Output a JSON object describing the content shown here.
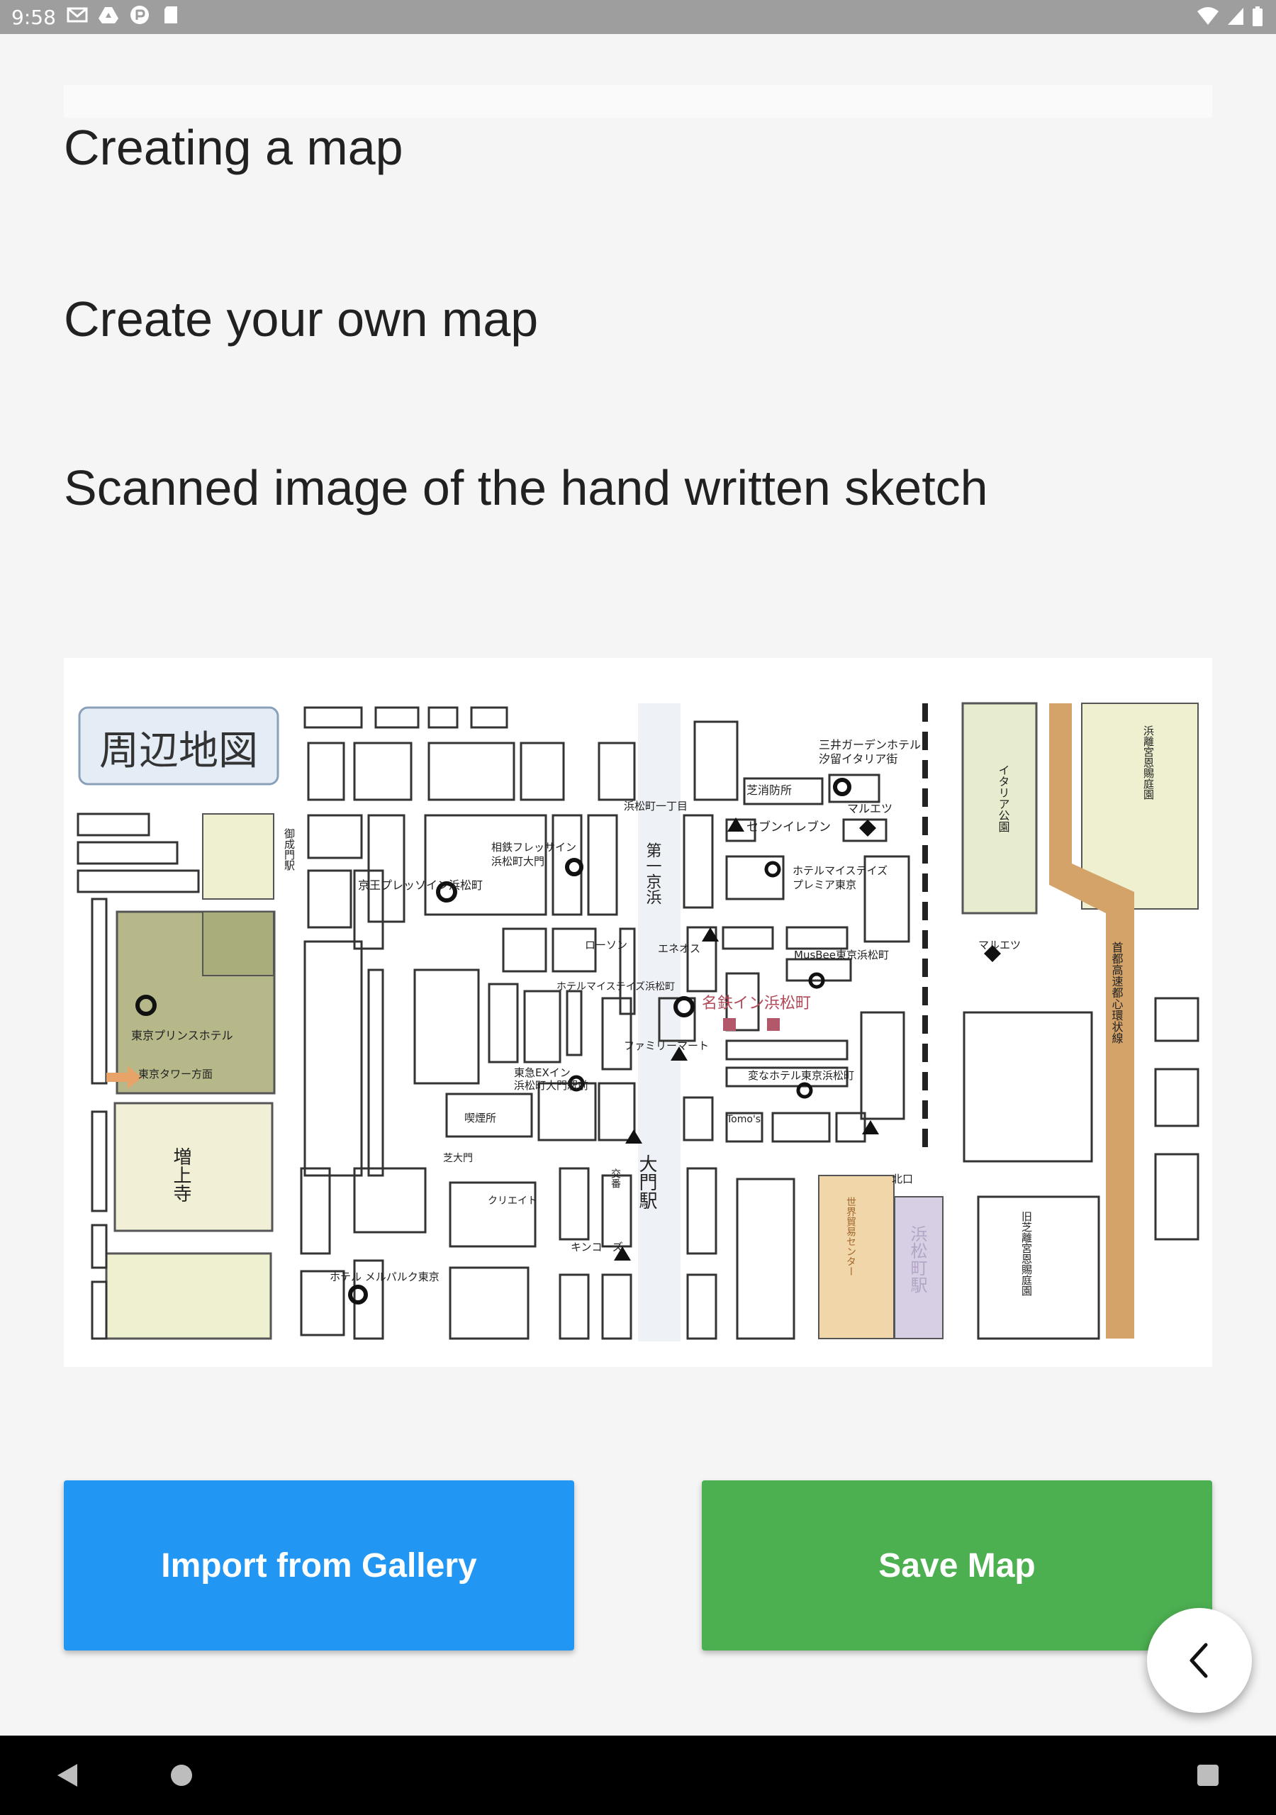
{
  "status_bar": {
    "time": "9:58",
    "icons": [
      "gmail-icon",
      "drive-icon",
      "pocket-icon",
      "sd-card-icon"
    ],
    "right_icons": [
      "wifi-icon",
      "signal-icon",
      "battery-icon"
    ]
  },
  "content": {
    "line1": "Creating a map",
    "line2": "Create your own map",
    "line3": "Scanned image of the hand written sketch"
  },
  "map": {
    "title": "周辺地図",
    "labels": [
      "三井ガーデンホテル",
      "汐留イタリア街",
      "芝消防所",
      "浜松町一丁目",
      "マルエツ",
      "セブンイレブン",
      "第一京浜",
      "相鉄フレッサイン",
      "浜松町大門",
      "京王プレッソイン浜松町",
      "ホテルマイステイズ",
      "プレミア東京",
      "ローソン",
      "エネオス",
      "MusBee東京浜松町",
      "ホテルマイステイズ浜松町",
      "名鉄イン浜松町",
      "ファミリーマート",
      "東京プリンスホテル",
      "東京タワー方面",
      "東急EXイン",
      "浜松町大門駅前",
      "変なホテル東京浜松町",
      "喫煙所",
      "Tomo's",
      "増上寺",
      "芝大門",
      "大門駅",
      "クリエイト",
      "キンコーズ",
      "ホテル メルパルク東京",
      "世界貿易センター",
      "北口",
      "浜松町駅",
      "イタリア公園",
      "旧芝離宮恩賜庭園",
      "首都高速都心環状線",
      "浜離宮恩賜庭園",
      "御成門駅",
      "交番"
    ]
  },
  "buttons": {
    "import_label": "Import from Gallery",
    "save_label": "Save Map"
  },
  "fab": {
    "icon": "chevron-left-icon"
  },
  "nav_bar": {
    "icons": [
      "back-triangle-icon",
      "home-circle-icon",
      "recents-square-icon"
    ]
  },
  "colors": {
    "import": "#2196f3",
    "save": "#4caf50",
    "status_bar": "#9e9e9e",
    "background": "#f5f5f5"
  }
}
